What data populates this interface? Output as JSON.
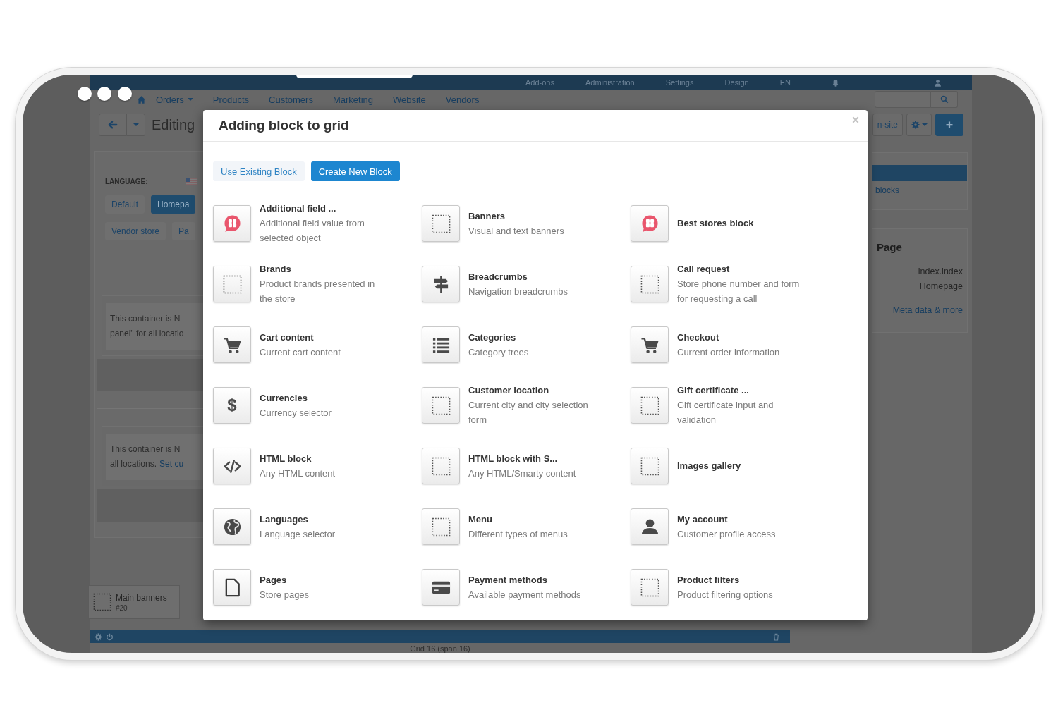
{
  "top_bar": {
    "items": [
      "Add-ons",
      "Administration",
      "Settings",
      "Design",
      "EN"
    ]
  },
  "nav": {
    "items": [
      {
        "label": "Orders",
        "dropdown": true
      },
      {
        "label": "Products",
        "dropdown": false
      },
      {
        "label": "Customers",
        "dropdown": false
      },
      {
        "label": "Marketing",
        "dropdown": false
      },
      {
        "label": "Website",
        "dropdown": false
      },
      {
        "label": "Vendors",
        "dropdown": false
      }
    ]
  },
  "toolbar": {
    "title": "Editing",
    "buttons": [
      {
        "kind": "text",
        "label": "n-site"
      },
      {
        "kind": "gear"
      },
      {
        "kind": "add"
      }
    ]
  },
  "layout_panel": {
    "language_label": "LANGUAGE:",
    "tab_rows": [
      [
        {
          "label": "Default",
          "selected": false
        },
        {
          "label": "Homepa",
          "selected": true
        }
      ],
      [
        {
          "label": "Vendor store",
          "selected": false
        },
        {
          "label": "Pa",
          "selected": false
        }
      ]
    ],
    "containers": [
      {
        "lines": [
          "This container is N",
          "panel\" for all locatio"
        ]
      },
      {
        "lines": [
          "This container is N",
          "all locations."
        ],
        "link": "Set cu"
      }
    ],
    "block": {
      "title": "Main banners",
      "number": "#20"
    }
  },
  "side_panel": {
    "link": "blocks",
    "page": {
      "heading": "Page",
      "values": [
        "index.index",
        "Homepage"
      ],
      "link": "Meta data & more"
    }
  },
  "grid": {
    "label": "Grid 16 (span 16)"
  },
  "modal": {
    "title": "Adding block to grid",
    "tabs": [
      {
        "label": "Use Existing Block",
        "selected": false
      },
      {
        "label": "Create New Block",
        "selected": true
      }
    ],
    "blocks": [
      {
        "title": "Additional field ...",
        "description": "Additional field value from selected object",
        "kind": "badge"
      },
      {
        "title": "Banners",
        "description": "Visual and text banners",
        "kind": "dotted"
      },
      {
        "title": "Best stores block",
        "kind": "badge"
      },
      {
        "title": "Brands",
        "description": "Product brands presented in the store",
        "kind": "dotted"
      },
      {
        "title": "Breadcrumbs",
        "description": "Navigation breadcrumbs",
        "kind": "signpost"
      },
      {
        "title": "Call request",
        "description": "Store phone number and form for requesting a call",
        "kind": "dotted"
      },
      {
        "title": "Cart content",
        "description": "Current cart content",
        "kind": "cart"
      },
      {
        "title": "Categories",
        "description": "Category trees",
        "kind": "list"
      },
      {
        "title": "Checkout",
        "description": "Current order information",
        "kind": "cart"
      },
      {
        "title": "Currencies",
        "description": "Currency selector",
        "kind": "dollar",
        "glyph": "$"
      },
      {
        "title": "Customer location",
        "description": "Current city and city selection form",
        "kind": "dotted"
      },
      {
        "title": "Gift certificate ...",
        "description": "Gift certificate input and validation",
        "kind": "dotted"
      },
      {
        "title": "HTML block",
        "description": "Any HTML content",
        "kind": "code"
      },
      {
        "title": "HTML block with S...",
        "description": "Any HTML/Smarty content",
        "kind": "dotted"
      },
      {
        "title": "Images gallery",
        "kind": "dotted"
      },
      {
        "title": "Languages",
        "description": "Language selector",
        "kind": "globe"
      },
      {
        "title": "Menu",
        "description": "Different types of menus",
        "kind": "dotted"
      },
      {
        "title": "My account",
        "description": "Customer profile access",
        "kind": "user"
      },
      {
        "title": "Pages",
        "description": "Store pages",
        "kind": "page"
      },
      {
        "title": "Payment methods",
        "description": "Available payment methods",
        "kind": "card"
      },
      {
        "title": "Product filters",
        "description": "Product filtering options",
        "kind": "dotted"
      }
    ]
  }
}
